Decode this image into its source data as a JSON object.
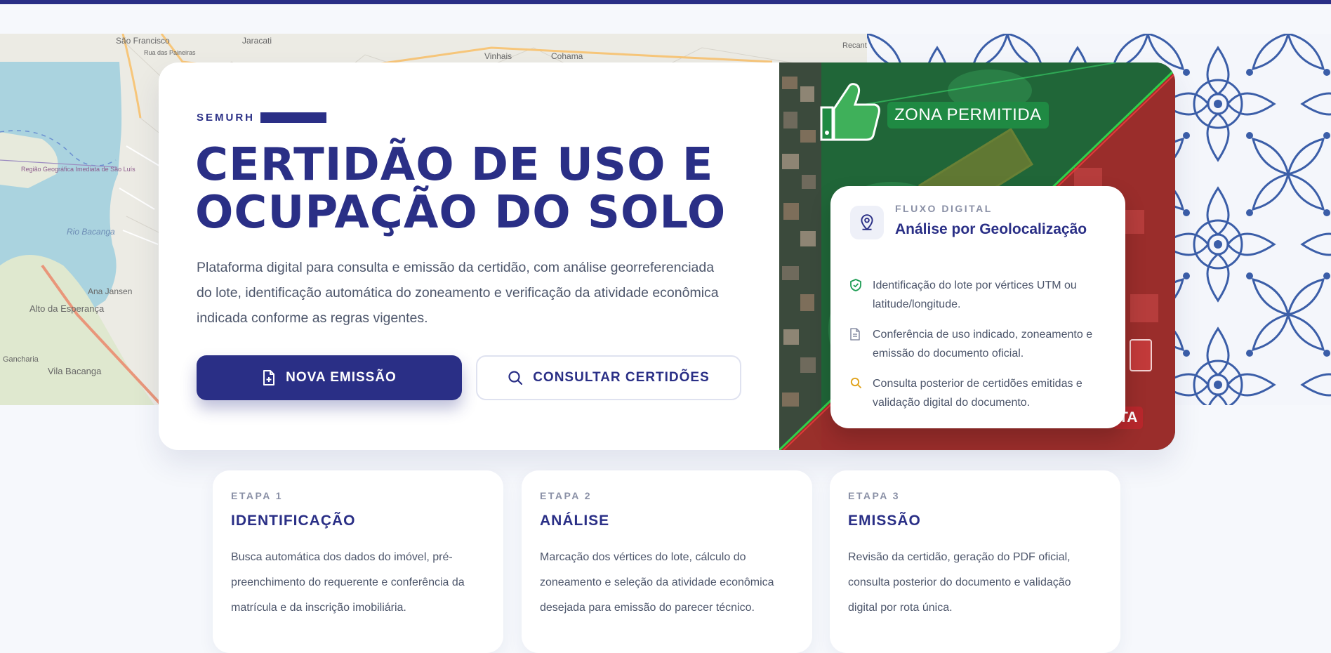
{
  "colors": {
    "brand": "#2a2f86",
    "zone_ok": "#1f8a43",
    "zone_bad": "#b8272c",
    "page_bg": "#f6f8fc"
  },
  "map_labels": [
    "São Francisco",
    "Jaracati",
    "Rua das Paineiras",
    "Vinhais",
    "Cohama",
    "Região Geográfica Imediata de São Luís",
    "Rio Bacanga",
    "Ana Jansen",
    "Alto da Esperança",
    "Gancharia",
    "Vila Bacanga",
    "Recanto"
  ],
  "hero": {
    "eyebrow": "SEMURH",
    "title": "CERTIDÃO DE USO E OCUPAÇÃO DO SOLO",
    "description": "Plataforma digital para consulta e emissão da certidão, com análise georreferenciada do lote, identificação automática do zoneamento e verificação da atividade econômica indicada conforme as regras vigentes.",
    "primary_button": "NOVA EMISSÃO",
    "primary_icon": "file-plus-icon",
    "secondary_button": "CONSULTAR CERTIDÕES",
    "secondary_icon": "search-icon"
  },
  "aerial": {
    "zone_permitted_label": "ZONA PERMITIDA",
    "zone_restricted_label_partial": "TA",
    "thumb_icon": "thumbs-up-icon"
  },
  "flow": {
    "eyebrow": "FLUXO DIGITAL",
    "title": "Análise por Geolocalização",
    "icon": "map-pin-icon",
    "items": [
      {
        "icon": "shield-check-icon",
        "icon_color": "#1f9d55",
        "text": "Identificação do lote por vértices UTM ou latitude/longitude."
      },
      {
        "icon": "document-icon",
        "icon_color": "#8a90a6",
        "text": "Conferência de uso indicado, zoneamento e emissão do documento oficial."
      },
      {
        "icon": "search-icon",
        "icon_color": "#e0a21a",
        "text": "Consulta posterior de certidões emitidas e validação digital do documento."
      }
    ]
  },
  "steps": [
    {
      "label": "ETAPA 1",
      "title": "IDENTIFICAÇÃO",
      "body": "Busca automática dos dados do imóvel, pré-preenchimento do requerente e conferência da matrícula e da inscrição imobiliária."
    },
    {
      "label": "ETAPA 2",
      "title": "ANÁLISE",
      "body": "Marcação dos vértices do lote, cálculo do zoneamento e seleção da atividade econômica desejada para emissão do parecer técnico."
    },
    {
      "label": "ETAPA 3",
      "title": "EMISSÃO",
      "body": "Revisão da certidão, geração do PDF oficial, consulta posterior do documento e validação digital por rota única."
    }
  ]
}
